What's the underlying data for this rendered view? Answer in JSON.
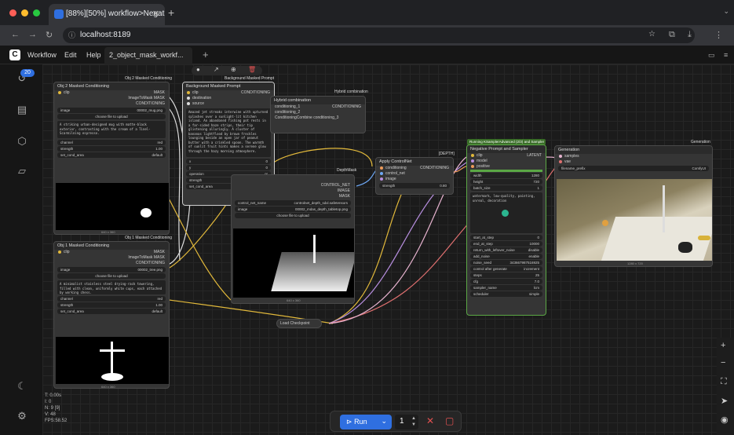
{
  "browser": {
    "tab_title": "[88%][50%] workflow>Negat...",
    "url": "localhost:8189"
  },
  "menu": {
    "workflow": "Workflow",
    "edit": "Edit",
    "help": "Help"
  },
  "workflow_tab": "2_object_mask_workf...",
  "queue_badge": "20",
  "groups": {
    "obj2": "Obj 2 Masked Conditioning",
    "bg": "Background Masked Prompt",
    "hybrid": "Hybrid combination",
    "depth": "DepthMask",
    "depth2": "[DEPTH]",
    "running": "Running KSamplerAdvanced (2/3)",
    "neg": "and Sampler",
    "generation": "Generation",
    "obj1": "Obj 1 Masked Conditioning"
  },
  "nodes": {
    "obj2": {
      "title": "Obj 2 Masked Conditioning",
      "clip": "clip",
      "mask": "MASK",
      "image_to_mask": "ImageToMask MASK",
      "conditioning": "CONDITIONING",
      "image_label": "image",
      "image_value": "00002_mug.png",
      "upload": "choose file to upload",
      "prompt": "A striking urban-designed mug with matte-black exterior, contrasting with the cream of a Tinel-Scarmilning espresso.",
      "channel": "channel",
      "channel_val": "red",
      "strength": "strength",
      "strength_val": "1.00",
      "set_cond_area": "set_cond_area",
      "set_cond_area_val": "default",
      "footer": "640 x 360"
    },
    "bg": {
      "title": "Background Masked Prompt",
      "clip": "clip",
      "destination": "destination",
      "source": "source",
      "conditioning": "CONDITIONING",
      "prompt": "Amazed jet streaks interwine with upturned splashes over a sunlight-lit kitchen island. An abandoned fishing pot rests in a far-sided haze strips, their tip glistening alluringly. A cluster of bananas lightflood by brown freckles lounging beside an open jar of peanut butter with a crinkled spoon. The warmth of sunlit fruit hints makes a serene glow through the hazy morning atmosphere.",
      "x": "x",
      "x_val": "0",
      "y": "y",
      "y_val": "0",
      "operation": "operation",
      "operation_val": "or",
      "strength": "strength",
      "strength_val": "1.00",
      "set_cond_area": "set_cond_area",
      "set_cond_area_val": "mask bounds"
    },
    "hybrid": {
      "title": "Hybrid combination",
      "c1": "conditioning_1",
      "c2": "conditioning_2",
      "out": "CONDITIONING",
      "combine": "ConditioningCombine conditioning_3"
    },
    "depth": {
      "title": "DepthMask",
      "control_net": "CONTROL_NET",
      "image": "IMAGE",
      "mask": "MASK",
      "cn_name": "control_net_name",
      "cn_val": "controlnet_depth_sdxl.safetensors",
      "image_label": "image",
      "image_val": "00002_mdas_depth_tabletop.png",
      "upload": "choose file to upload",
      "footer": "640 x 360"
    },
    "apply": {
      "title": "Apply ControlNet",
      "conditioning": "conditioning",
      "control_net": "control_net",
      "image": "image",
      "out": "CONDITIONING",
      "strength": "strength",
      "strength_val": "0.80"
    },
    "neg": {
      "title": "Negative Prompt and Sampler",
      "clip": "clip",
      "model": "model",
      "positive": "positive",
      "latent": "LATENT",
      "width": "width",
      "width_val": "1280",
      "height": "height",
      "height_val": "720",
      "batch": "batch_size",
      "batch_val": "1",
      "prompt": "watermark, low-quality, painting, unreal, decoration",
      "start_at_step": "start_at_step",
      "start_val": "0",
      "end_at_step": "end_at_step",
      "end_val": "10000",
      "return_noise": "return_with_leftover_noise",
      "return_val": "disable",
      "add_noise": "add_noise",
      "add_val": "enable",
      "noise_seed": "noise_seed",
      "seed_val": "343667987516925",
      "control": "control after generate",
      "control_val": "increment",
      "steps": "steps",
      "steps_val": "25",
      "cfg": "cfg",
      "cfg_val": "7.0",
      "sampler": "sampler_name",
      "sampler_val": "lcm",
      "scheduler": "scheduler",
      "scheduler_val": "simple"
    },
    "gen": {
      "title": "Generation",
      "samples": "samples",
      "vae": "vae",
      "filename": "filename_prefix",
      "filename_val": "ComfyUI",
      "footer": "1280 x 720"
    },
    "obj1": {
      "title": "Obj 1 Masked Conditioning",
      "clip": "clip",
      "mask": "MASK",
      "image_to_mask": "ImageToMask MASK",
      "conditioning": "CONDITIONING",
      "image_label": "image",
      "image_value": "00002_tree.png",
      "upload": "choose file to upload",
      "prompt": "A minimalist stainless steel drying-rack towering, filled with clean, uniformly white cups, each attached by working chess.",
      "channel": "channel",
      "channel_val": "red",
      "strength": "strength",
      "strength_val": "1.00",
      "set_cond_area": "set_cond_area",
      "set_cond_area_val": "default",
      "footer": "640 x 360"
    },
    "checkpoint": {
      "title": "Load Checkpoint"
    }
  },
  "stats": {
    "t": "T: 0.00s",
    "i": "I: 0",
    "n": "N: 9 [9]",
    "v": "V: 48",
    "fps": "FPS:58.52"
  },
  "run": {
    "label": "Run",
    "count": "1"
  },
  "colors": {
    "accent": "#2f6fe0",
    "running_group": "#3a6e28",
    "canvas": "#1b1b1b"
  }
}
